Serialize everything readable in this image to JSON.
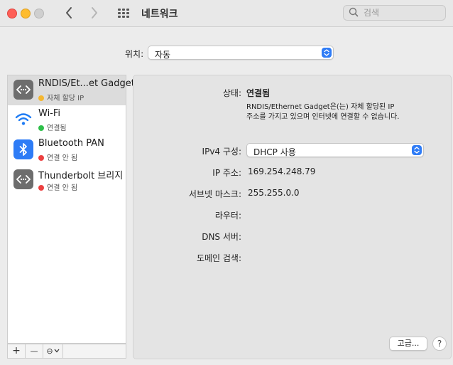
{
  "window": {
    "title": "네트워크"
  },
  "search": {
    "placeholder": "검색"
  },
  "location": {
    "label": "위치:",
    "value": "자동"
  },
  "services": [
    {
      "name": "RNDIS/Et...et Gadget",
      "status": "자체 할당 IP",
      "status_color": "#f5b731",
      "icon": "ethernet-icon",
      "selected": true
    },
    {
      "name": "Wi-Fi",
      "status": "연결됨",
      "status_color": "#2fbf4a",
      "icon": "wifi-icon"
    },
    {
      "name": "Bluetooth PAN",
      "status": "연결 안 됨",
      "status_color": "#ec4040",
      "icon": "bluetooth-icon"
    },
    {
      "name": "Thunderbolt 브리지",
      "status": "연결 안 됨",
      "status_color": "#ec4040",
      "icon": "ethernet-icon"
    }
  ],
  "toolbar": {
    "add": "+",
    "remove": "—",
    "action": "⊖"
  },
  "detail": {
    "status_label": "상태:",
    "status_value": "연결됨",
    "status_desc_line1": "RNDIS/Ethernet Gadget은(는) 자체 할당된 IP",
    "status_desc_line2": "주소를 가지고 있으며 인터넷에 연결할 수 없습니다.",
    "ipv4_label": "IPv4 구성:",
    "ipv4_value": "DHCP 사용",
    "ip_label": "IP 주소:",
    "ip_value": "169.254.248.79",
    "subnet_label": "서브넷 마스크:",
    "subnet_value": "255.255.0.0",
    "router_label": "라우터:",
    "dns_label": "DNS 서버:",
    "domain_label": "도메인 검색:",
    "advanced_button": "고급...",
    "help_button": "?"
  },
  "colors": {
    "accent": "#2f7cf6"
  }
}
